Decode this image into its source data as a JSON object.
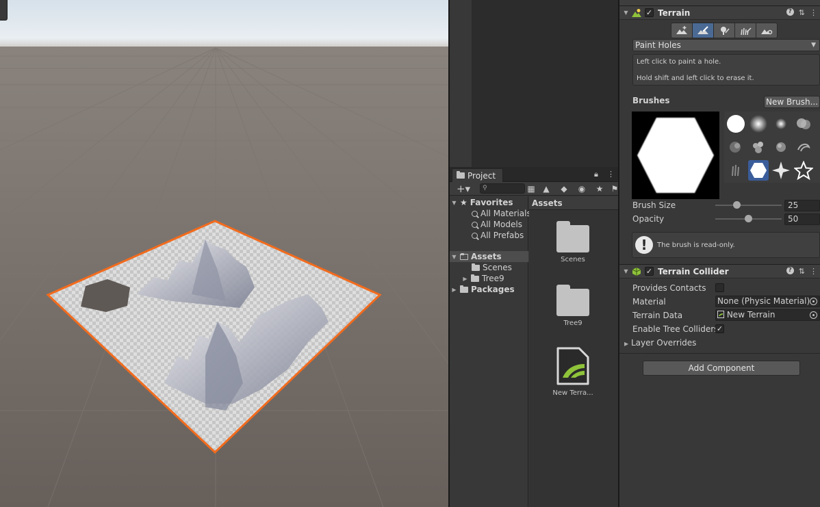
{
  "project": {
    "tab_label": "Project",
    "grid_header": "Assets",
    "tree": {
      "favorites": "Favorites",
      "favorites_items": [
        "All Materials",
        "All Models",
        "All Prefabs"
      ],
      "assets": "Assets",
      "assets_children": [
        "Scenes",
        "Tree9"
      ],
      "packages": "Packages"
    },
    "assets": [
      {
        "label": "Scenes",
        "kind": "folder"
      },
      {
        "label": "Tree9",
        "kind": "folder"
      },
      {
        "label": "New Terra...",
        "kind": "terrain-data"
      }
    ]
  },
  "inspector": {
    "terrain": {
      "title": "Terrain",
      "enabled": true,
      "tool_dropdown": "Paint Holes",
      "help_lines": [
        "Left click to paint a hole.",
        "Hold shift and left click to erase it."
      ],
      "brushes_label": "Brushes",
      "new_brush_button": "New Brush...",
      "brush_size_label": "Brush Size",
      "brush_size_value": "25",
      "brush_size_fraction": 0.3,
      "opacity_label": "Opacity",
      "opacity_value": "50",
      "opacity_fraction": 0.5,
      "readonly_message": "The brush is read-only."
    },
    "collider": {
      "title": "Terrain Collider",
      "enabled": true,
      "provides_contacts_label": "Provides Contacts",
      "provides_contacts": false,
      "material_label": "Material",
      "material_value": "None (Physic Material)",
      "terrain_data_label": "Terrain Data",
      "terrain_data_value": "New Terrain",
      "enable_tree_colliders_label": "Enable Tree Colliders",
      "enable_tree_colliders": true,
      "layer_overrides_label": "Layer Overrides"
    },
    "add_component_button": "Add Component"
  },
  "colors": {
    "selection_outline": "#f26b1d",
    "active_tool": "#4a6a94",
    "terrain_data_icon": "#8fc33a"
  },
  "icons": {
    "lock": "lock-icon",
    "kebab": "kebab-menu-icon",
    "help": "help-icon",
    "presets": "presets-icon",
    "more": "more-icon"
  }
}
